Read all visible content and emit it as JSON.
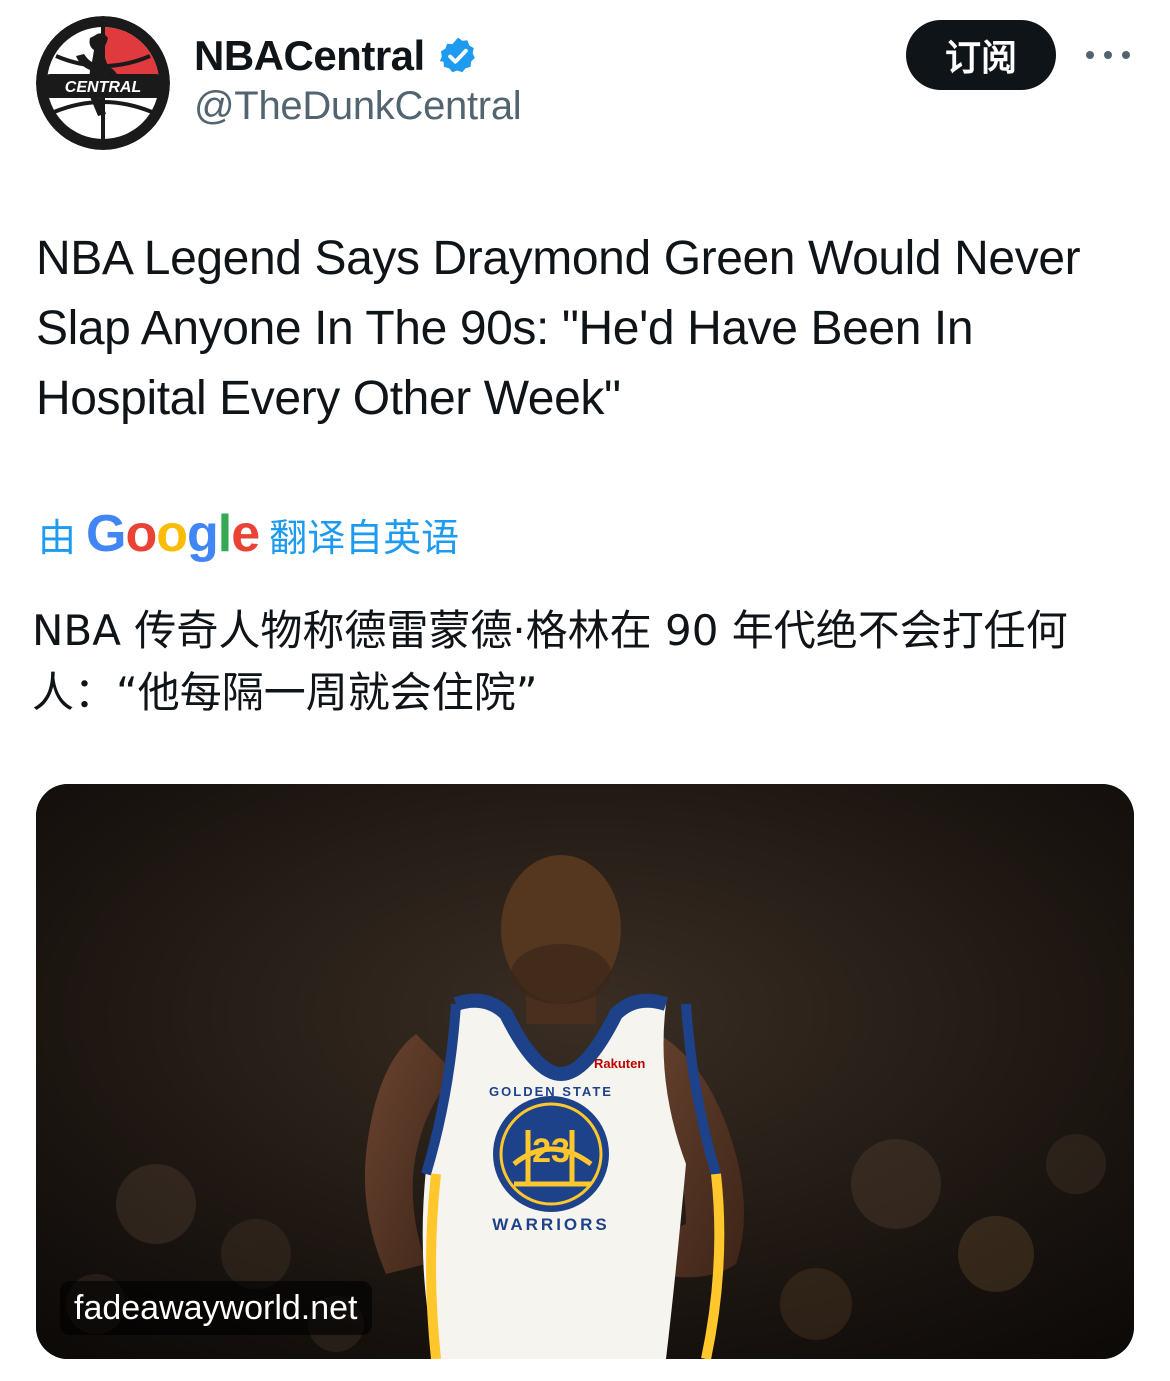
{
  "author": {
    "display_name": "NBACentral",
    "handle": "@TheDunkCentral",
    "avatar_text": "CENTRAL",
    "verified_icon": "verified-badge-icon"
  },
  "actions": {
    "subscribe_label": "订阅",
    "more_icon": "more-icon"
  },
  "tweet": {
    "text": "NBA Legend Says Draymond Green Would Never Slap Anyone In The 90s: \"He'd Have Been In Hospital Every Other Week\""
  },
  "translation": {
    "prefix": "由",
    "provider": "Google",
    "suffix": "翻译自英语",
    "text": "NBA 传奇人物称德雷蒙德·格林在 90 年代绝不会打任何人：“他每隔一周就会住院”"
  },
  "media": {
    "source_label": "fadeawayworld.net",
    "jersey_number": "23",
    "jersey_arc_top": "GOLDEN STATE",
    "jersey_arc_bottom": "WARRIORS",
    "sponsor": "Rakuten"
  },
  "colors": {
    "text_primary": "#0f1419",
    "text_secondary": "#536471",
    "link_blue": "#1d9bf0",
    "button_black": "#0f1419",
    "warriors_blue": "#1d428a",
    "warriors_gold": "#ffc72c",
    "google_blue": "#4285f4",
    "google_red": "#ea4335",
    "google_yellow": "#fbbc05",
    "google_green": "#34a853"
  }
}
